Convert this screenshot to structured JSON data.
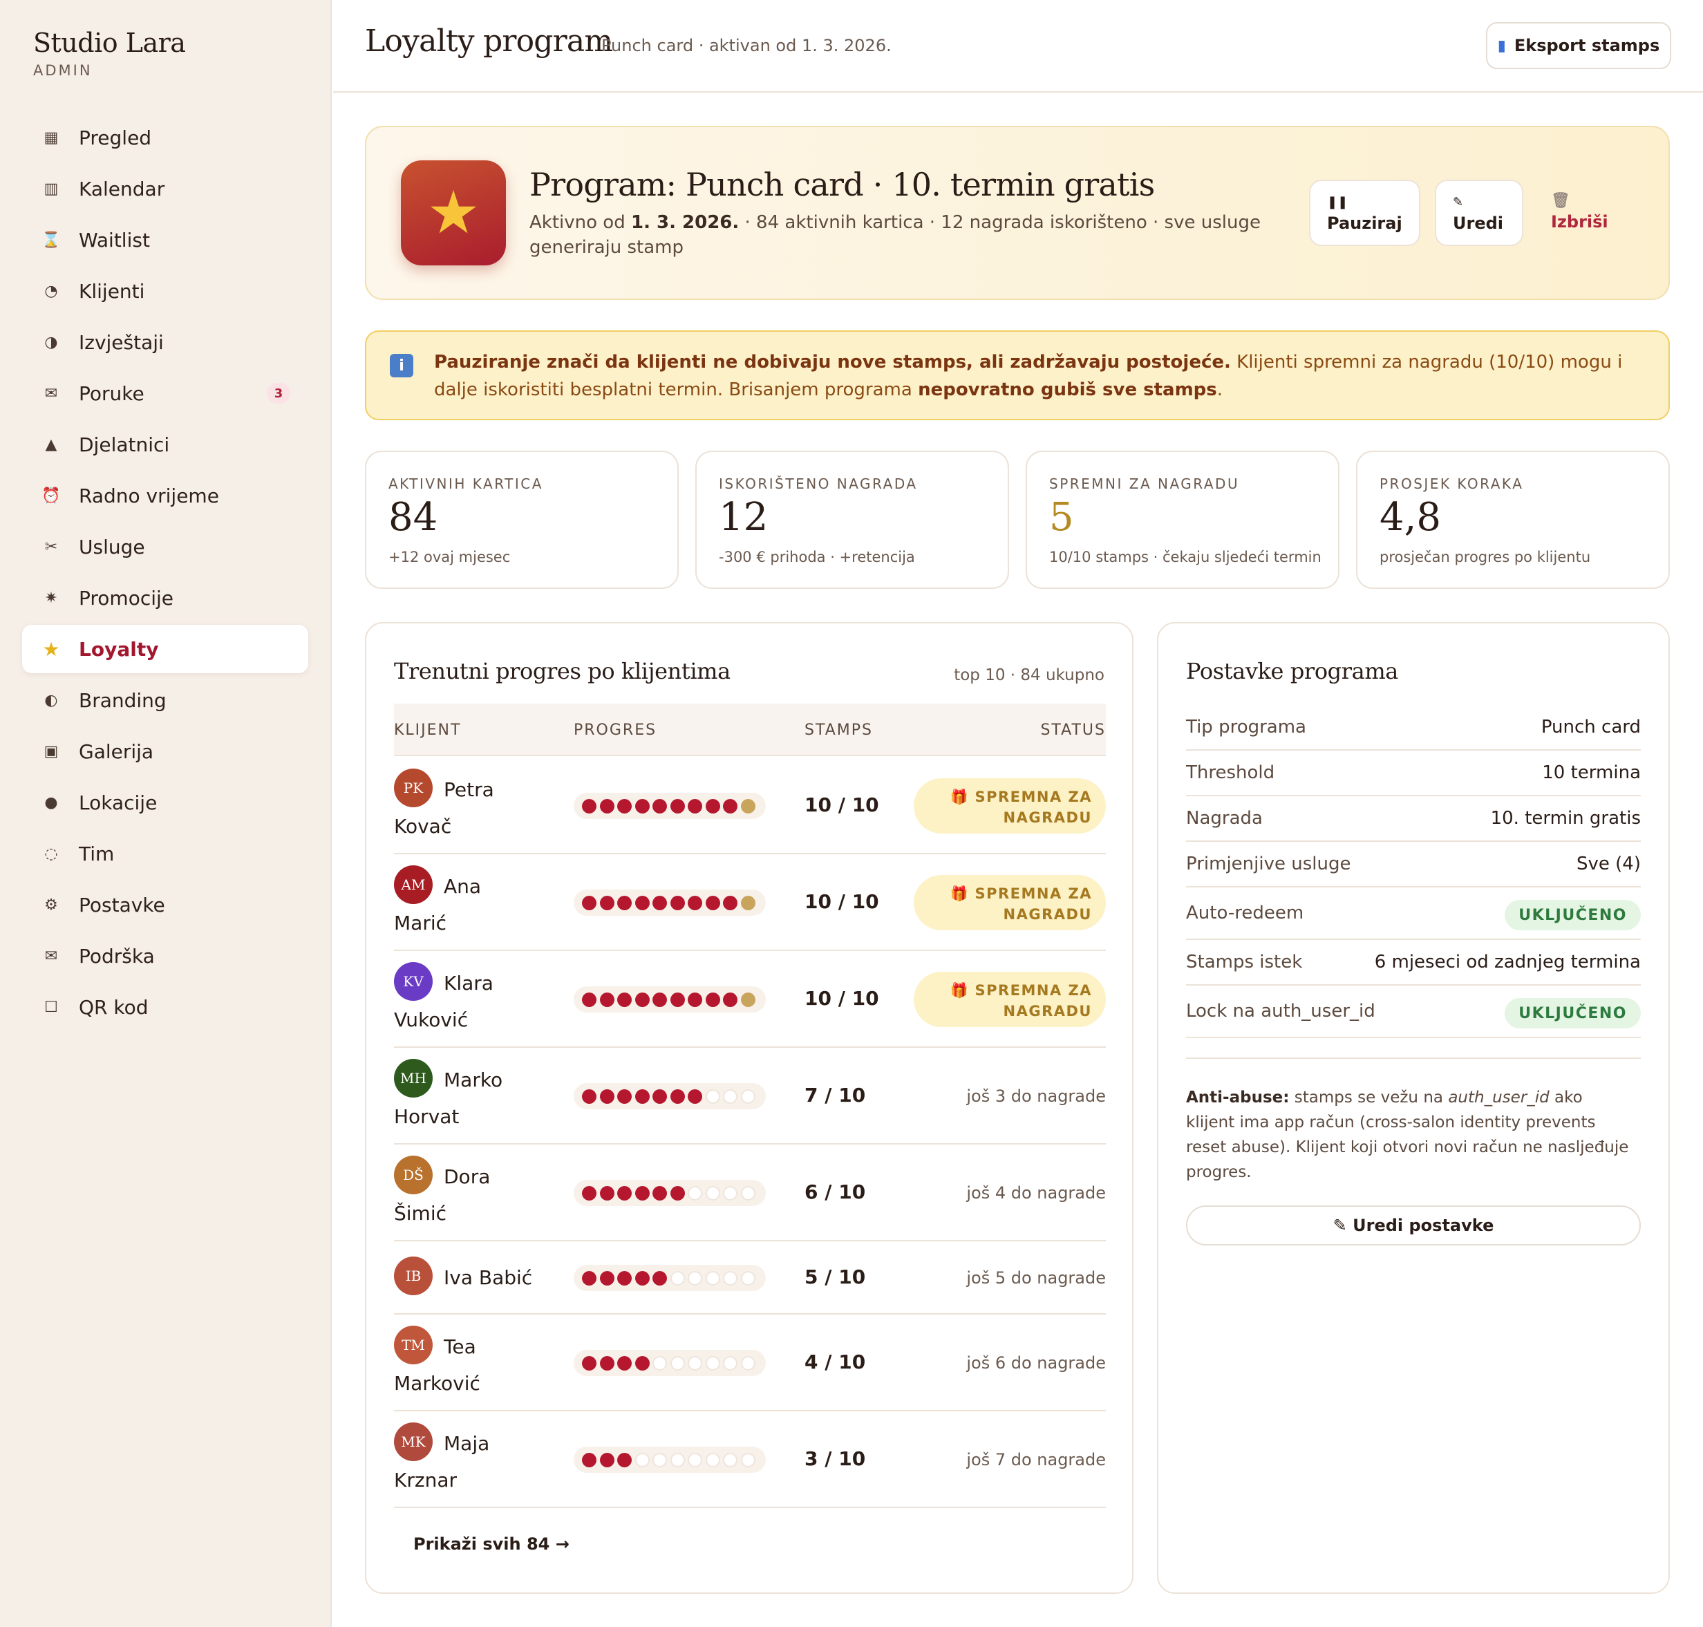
{
  "sidebar": {
    "brand": "Studio Lara",
    "brand_sub": "ADMIN",
    "items": [
      {
        "icon": "▦",
        "label": "Pregled"
      },
      {
        "icon": "▥",
        "label": "Kalendar"
      },
      {
        "icon": "⌛",
        "label": "Waitlist"
      },
      {
        "icon": "◔",
        "label": "Klijenti"
      },
      {
        "icon": "◑",
        "label": "Izvještaji"
      },
      {
        "icon": "✉",
        "label": "Poruke",
        "badge": "3"
      },
      {
        "icon": "▲",
        "label": "Djelatnici"
      },
      {
        "icon": "⏰",
        "label": "Radno vrijeme"
      },
      {
        "icon": "✂",
        "label": "Usluge"
      },
      {
        "icon": "✷",
        "label": "Promocije"
      },
      {
        "icon": "★",
        "label": "Loyalty"
      },
      {
        "icon": "◐",
        "label": "Branding"
      },
      {
        "icon": "▣",
        "label": "Galerija"
      },
      {
        "icon": "●",
        "label": "Lokacije"
      },
      {
        "icon": "◌",
        "label": "Tim"
      },
      {
        "icon": "⚙",
        "label": "Postavke"
      },
      {
        "icon": "✉",
        "label": "Podrška"
      },
      {
        "icon": "☐",
        "label": "QR kod"
      }
    ]
  },
  "header": {
    "title": "Loyalty program",
    "subtitle": "Punch card · aktivan od 1. 3. 2026.",
    "export_label": "Eksport stamps",
    "export_icon": "▮"
  },
  "hero": {
    "title": "Program: Punch card · 10. termin gratis",
    "desc_prefix": "Aktivno od ",
    "desc_date": "1. 3. 2026.",
    "desc_rest": " · 84 aktivnih kartica · 12 nagrada iskorišteno · sve usluge generiraju stamp",
    "pause_label": "Pauziraj",
    "pause_icon": "❚❚",
    "edit_label": "Uredi",
    "edit_icon": "✎",
    "delete_label": "Izbriši",
    "delete_icon": "🗑"
  },
  "alert": {
    "bold1": "Pauziranje znači da klijenti ne dobivaju nove stamps, ali zadržavaju postojeće.",
    "text1": " Klijenti spremni za nagradu (10/10) mogu i dalje iskoristiti besplatni termin. Brisanjem programa ",
    "bold2": "nepovratno gubiš sve stamps",
    "text2": "."
  },
  "stats": [
    {
      "label": "AKTIVNIH KARTICA",
      "value": "84",
      "note": "+12 ovaj mjesec",
      "gold": false
    },
    {
      "label": "ISKORIŠTENO NAGRADA",
      "value": "12",
      "note": "-300 € prihoda · +retencija",
      "gold": false
    },
    {
      "label": "SPREMNI ZA NAGRADU",
      "value": "5",
      "note": "10/10 stamps · čekaju sljedeći termin",
      "gold": true
    },
    {
      "label": "PROSJEK KORAKA",
      "value": "4,8",
      "note": "prosječan progres po klijentu",
      "gold": false
    }
  ],
  "progress": {
    "title": "Trenutni progres po klijentima",
    "meta": "top 10 · 84 ukupno",
    "columns": {
      "client": "KLIJENT",
      "progress": "PROGRES",
      "stamps": "STAMPS",
      "status": "STATUS"
    },
    "ready_line1": "SPREMNA ZA",
    "ready_line2": "NAGRADU",
    "rows": [
      {
        "initials": "PK",
        "first": "Petra",
        "last": "Kovač",
        "stamps": 10,
        "label": "10 / 10",
        "remaining": "",
        "color": "#b5492e"
      },
      {
        "initials": "AM",
        "first": "Ana",
        "last": "Marić",
        "stamps": 10,
        "label": "10 / 10",
        "remaining": "",
        "color": "#a81c24"
      },
      {
        "initials": "KV",
        "first": "Klara",
        "last": "Vuković",
        "stamps": 10,
        "label": "10 / 10",
        "remaining": "",
        "color": "#6a3bc4"
      },
      {
        "initials": "MH",
        "first": "Marko",
        "last": "Horvat",
        "stamps": 7,
        "label": "7 / 10",
        "remaining": "još 3 do nagrade",
        "color": "#2f5a1e"
      },
      {
        "initials": "DŠ",
        "first": "Dora",
        "last": "Šimić",
        "stamps": 6,
        "label": "6 / 10",
        "remaining": "još 4 do nagrade",
        "color": "#b8722e"
      },
      {
        "initials": "IB",
        "first": "Iva Babić",
        "last": "",
        "stamps": 5,
        "label": "5 / 10",
        "remaining": "još 5 do nagrade",
        "color": "#b8503a"
      },
      {
        "initials": "TM",
        "first": "Tea",
        "last": "Marković",
        "stamps": 4,
        "label": "4 / 10",
        "remaining": "još 6 do nagrade",
        "color": "#c0573a"
      },
      {
        "initials": "MK",
        "first": "Maja",
        "last": "Krznar",
        "stamps": 3,
        "label": "3 / 10",
        "remaining": "još 7 do nagrade",
        "color": "#b04a3c"
      }
    ],
    "threshold": 10,
    "show_all": "Prikaži svih 84 →"
  },
  "settings": {
    "title": "Postavke programa",
    "rows": [
      {
        "key": "Tip programa",
        "value": "Punch card",
        "pill": false
      },
      {
        "key": "Threshold",
        "value": "10 termina",
        "pill": false
      },
      {
        "key": "Nagrada",
        "value": "10. termin gratis",
        "pill": false
      },
      {
        "key": "Primjenjive usluge",
        "value": "Sve (4)",
        "pill": false
      },
      {
        "key": "Auto-redeem",
        "value": "UKLJUČENO",
        "pill": true
      },
      {
        "key": "Stamps istek",
        "value": "6 mjeseci od zadnjeg termina",
        "pill": false
      },
      {
        "key": "Lock na auth_user_id",
        "value": "UKLJUČENO",
        "pill": true
      }
    ],
    "anti_bold": "Anti-abuse:",
    "anti_text1": " stamps se vežu na ",
    "anti_italic": "auth_user_id",
    "anti_text2": " ako klijent ima app račun (cross-salon identity prevents reset abuse). Klijent koji otvori novi račun ne nasljeđuje progres.",
    "edit_label": "✎ Uredi postavke"
  }
}
